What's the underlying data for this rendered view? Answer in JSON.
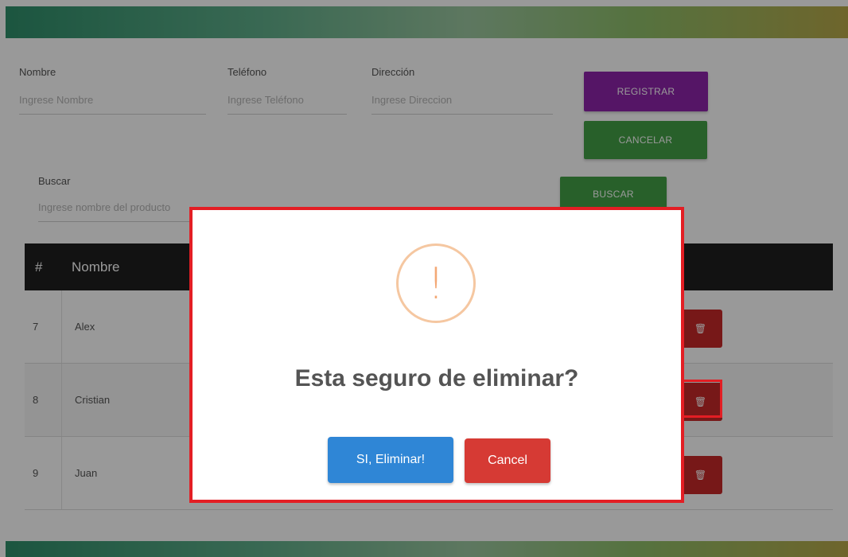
{
  "form": {
    "nombre": {
      "label": "Nombre",
      "placeholder": "Ingrese Nombre"
    },
    "telefono": {
      "label": "Teléfono",
      "placeholder": "Ingrese Teléfono"
    },
    "direccion": {
      "label": "Dirección",
      "placeholder": "Ingrese Direccion"
    },
    "register_label": "REGISTRAR",
    "cancel_label": "CANCELAR"
  },
  "search": {
    "label": "Buscar",
    "placeholder": "Ingrese nombre del producto",
    "button_label": "BUSCAR"
  },
  "table": {
    "headers": [
      "#",
      "Nombre"
    ],
    "rows": [
      {
        "id": "7",
        "name": "Alex"
      },
      {
        "id": "8",
        "name": "Cristian"
      },
      {
        "id": "9",
        "name": "Juan"
      }
    ],
    "delete_icon": "trash-icon"
  },
  "dialog": {
    "icon": "exclamation-icon",
    "title": "Esta seguro de eliminar?",
    "confirm_label": "SI, Eliminar!",
    "cancel_label": "Cancel"
  },
  "colors": {
    "purple": "#8e24aa",
    "green": "#43a047",
    "danger": "#c62828",
    "confirm": "#2f86d6",
    "highlight": "#e31e24"
  }
}
